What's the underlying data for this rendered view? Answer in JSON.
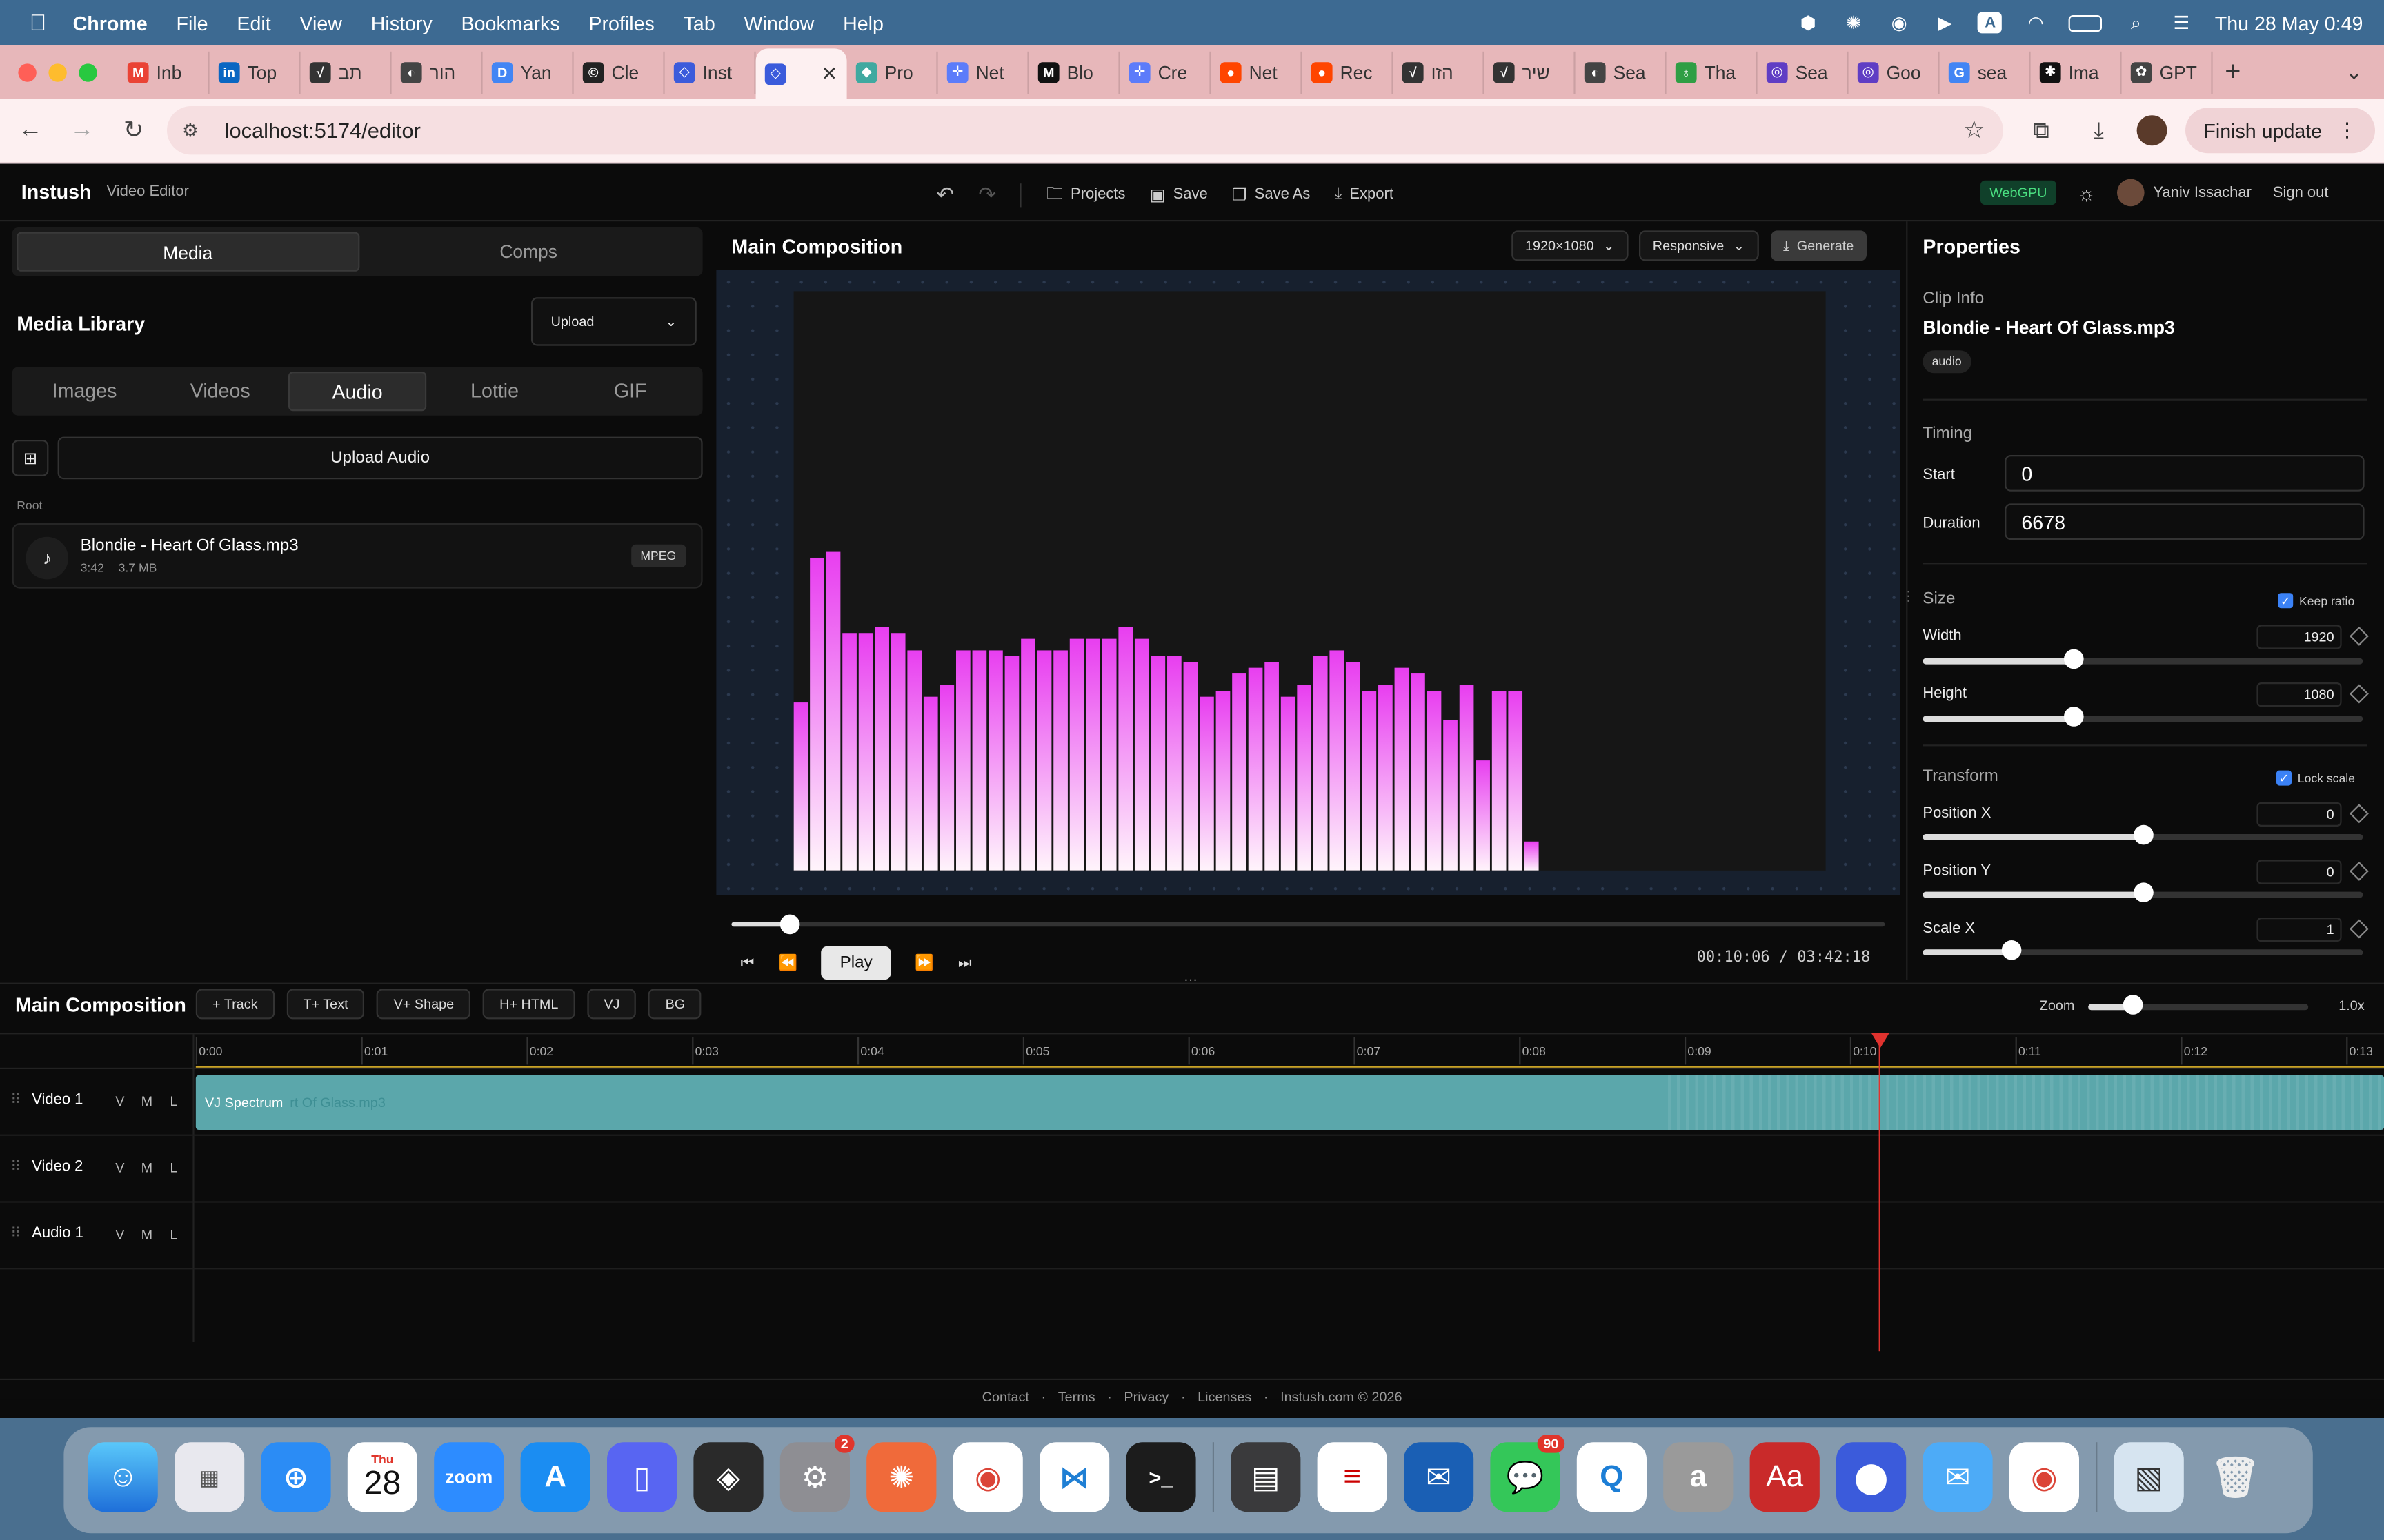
{
  "menubar": {
    "items": [
      "Chrome",
      "File",
      "Edit",
      "View",
      "History",
      "Bookmarks",
      "Profiles",
      "Tab",
      "Window",
      "Help"
    ],
    "clock": "Thu 28 May  0:49"
  },
  "tabs": [
    {
      "label": "Inb",
      "fav": "M",
      "color": "#ea4335"
    },
    {
      "label": "Top",
      "fav": "in",
      "color": "#0a66c2"
    },
    {
      "label": "תב",
      "fav": "√",
      "color": "#333333"
    },
    {
      "label": "הור",
      "fav": "◐",
      "color": "#444444"
    },
    {
      "label": "Yan",
      "fav": "D",
      "color": "#4285f4"
    },
    {
      "label": "Cle",
      "fav": "©",
      "color": "#222222"
    },
    {
      "label": "Inst",
      "fav": "◇",
      "color": "#3b5bdb"
    },
    {
      "label": "",
      "fav": "◇",
      "color": "#3b5bdb",
      "active": true
    },
    {
      "label": "Pro",
      "fav": "◆",
      "color": "#3fa9a0"
    },
    {
      "label": "Net",
      "fav": "✛",
      "color": "#5c7cfa"
    },
    {
      "label": "Blo",
      "fav": "M",
      "color": "#111111"
    },
    {
      "label": "Cre",
      "fav": "✛",
      "color": "#5c7cfa"
    },
    {
      "label": "Net",
      "fav": "●",
      "color": "#ff4500"
    },
    {
      "label": "Rec",
      "fav": "●",
      "color": "#ff4500"
    },
    {
      "label": "הזו",
      "fav": "√",
      "color": "#333333"
    },
    {
      "label": "שיר",
      "fav": "√",
      "color": "#333333"
    },
    {
      "label": "Sea",
      "fav": "◐",
      "color": "#444444"
    },
    {
      "label": "Tha",
      "fav": "♁",
      "color": "#2f9e44"
    },
    {
      "label": "Sea",
      "fav": "◎",
      "color": "#5f3dc4"
    },
    {
      "label": "Goo",
      "fav": "◎",
      "color": "#5f3dc4"
    },
    {
      "label": "sea",
      "fav": "G",
      "color": "#4285f4"
    },
    {
      "label": "Ima",
      "fav": "✱",
      "color": "#111111"
    },
    {
      "label": "GPT",
      "fav": "✿",
      "color": "#444444"
    }
  ],
  "address": {
    "url": "localhost:5174/editor",
    "finish_update": "Finish update"
  },
  "app": {
    "brand": "Instush",
    "subtitle": "Video Editor",
    "actions": {
      "projects": "Projects",
      "save": "Save",
      "save_as": "Save As",
      "export": "Export"
    },
    "webgpu": "WebGPU",
    "user": "Yaniv Issachar",
    "signout": "Sign out"
  },
  "left": {
    "tabs": [
      {
        "label": "Media",
        "active": true
      },
      {
        "label": "Comps",
        "active": false
      }
    ],
    "title": "Media Library",
    "upload_select": "Upload",
    "filters": [
      {
        "label": "Images",
        "active": false
      },
      {
        "label": "Videos",
        "active": false
      },
      {
        "label": "Audio",
        "active": true
      },
      {
        "label": "Lottie",
        "active": false
      },
      {
        "label": "GIF",
        "active": false
      }
    ],
    "upload_audio": "Upload Audio",
    "root": "Root",
    "item": {
      "name": "Blondie - Heart Of Glass.mp3",
      "duration": "3:42",
      "size": "3.7 MB",
      "badge": "MPEG"
    }
  },
  "center": {
    "title": "Main Composition",
    "resolution": "1920×1080",
    "mode": "Responsive",
    "generate": "Generate",
    "play": "Play",
    "time": "00:10:06 / 03:42:18",
    "progress": 0.05,
    "spectrum": [
      0.29,
      0.54,
      0.55,
      0.41,
      0.41,
      0.42,
      0.41,
      0.38,
      0.3,
      0.32,
      0.38,
      0.38,
      0.38,
      0.37,
      0.4,
      0.38,
      0.38,
      0.4,
      0.4,
      0.4,
      0.42,
      0.4,
      0.37,
      0.37,
      0.36,
      0.3,
      0.31,
      0.34,
      0.35,
      0.36,
      0.3,
      0.32,
      0.37,
      0.38,
      0.36,
      0.31,
      0.32,
      0.35,
      0.34,
      0.31,
      0.26,
      0.32,
      0.19,
      0.31,
      0.31,
      0.05
    ]
  },
  "props": {
    "title": "Properties",
    "clip_info": "Clip Info",
    "clip_name": "Blondie - Heart Of Glass.mp3",
    "clip_type": "audio",
    "timing": "Timing",
    "start_label": "Start",
    "start": "0",
    "duration_label": "Duration",
    "duration": "6678",
    "size": "Size",
    "keep_ratio": "Keep ratio",
    "width_label": "Width",
    "width": "1920",
    "width_pct": 0.34,
    "height_label": "Height",
    "height": "1080",
    "height_pct": 0.34,
    "transform": "Transform",
    "lock_scale": "Lock scale",
    "pos_x_label": "Position X",
    "pos_x": "0",
    "pos_x_pct": 0.5,
    "pos_y_label": "Position Y",
    "pos_y": "0",
    "pos_y_pct": 0.5,
    "scale_x_label": "Scale X",
    "scale_x": "1",
    "scale_x_pct": 0.2
  },
  "timeline": {
    "title": "Main Composition",
    "buttons": [
      "+ Track",
      "T+ Text",
      "V+ Shape",
      "H+ HTML",
      "VJ",
      "BG"
    ],
    "zoom_label": "Zoom",
    "zoom_value": "1.0x",
    "zoom_pct": 0.2,
    "ticks": [
      "0:00",
      "0:01",
      "0:02",
      "0:03",
      "0:04",
      "0:05",
      "0:06",
      "0:07",
      "0:08",
      "0:09",
      "0:10",
      "0:11",
      "0:12",
      "0:13"
    ],
    "tracks": [
      {
        "name": "Video 1",
        "v": "V",
        "m": "M",
        "l": "L"
      },
      {
        "name": "Video 2",
        "v": "V",
        "m": "M",
        "l": "L"
      },
      {
        "name": "Audio 1",
        "v": "V",
        "m": "M",
        "l": "L"
      }
    ],
    "clip_label": "VJ Spectrum",
    "clip_sub": "rt Of Glass.mp3",
    "footer": [
      "Contact",
      "Terms",
      "Privacy",
      "Licenses",
      "Instush.com © 2026"
    ]
  },
  "dock": {
    "cal_day": "Thu",
    "cal_num": "28",
    "zoom": "zoom",
    "settings_badge": "2",
    "messages_badge": "90"
  }
}
